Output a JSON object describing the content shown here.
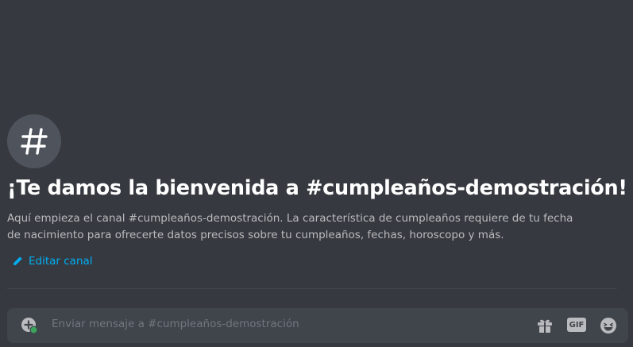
{
  "welcome": {
    "channel_symbol": "#",
    "title": "¡Te damos la bienvenida a #cumpleaños-demostración!",
    "description": "Aquí empieza el canal #cumpleaños-demostración. La característica de cumpleaños requiere de tu fecha de nacimiento para ofrecerte datos precisos sobre tu cumpleaños, fechas, horoscopo y más.",
    "edit_label": "Editar canal"
  },
  "composer": {
    "placeholder": "Enviar mensaje a #cumpleaños-demostración",
    "value": "",
    "gif_label": "GIF"
  },
  "icons": {
    "channel": "hashtag-icon",
    "edit": "pencil-icon",
    "add": "plus-circle-icon",
    "gift": "gift-icon",
    "gif": "gif-icon",
    "emoji": "emoji-icon"
  },
  "colors": {
    "background": "#36393f",
    "accent_link": "#00aff4",
    "composer_bg": "#40444b",
    "status_green": "#3ba55c"
  }
}
